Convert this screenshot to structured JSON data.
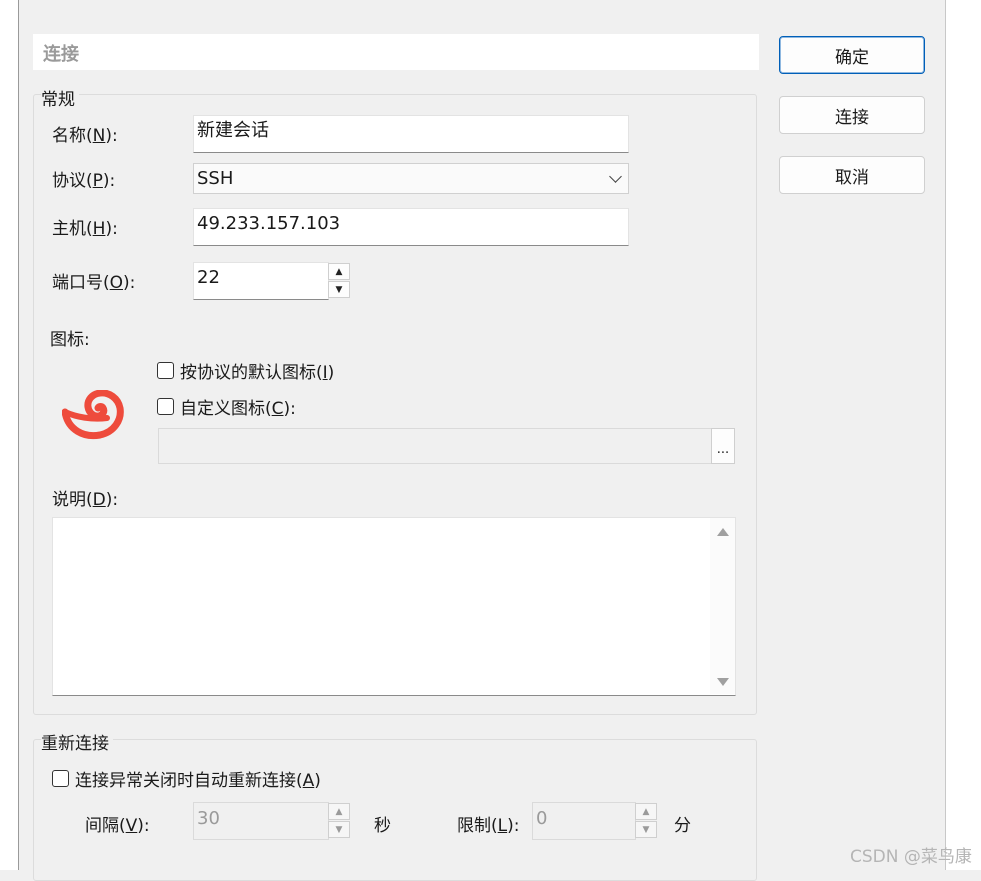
{
  "header": {
    "title": "连接"
  },
  "general": {
    "group_title": "常规",
    "name_label_pre": "名称(",
    "name_label_key": "N",
    "name_label_post": "):",
    "name_value": "新建会话",
    "protocol_label_pre": "协议(",
    "protocol_label_key": "P",
    "protocol_label_post": "):",
    "protocol_value": "SSH",
    "host_label_pre": "主机(",
    "host_label_key": "H",
    "host_label_post": "):",
    "host_value": "49.233.157.103",
    "port_label_pre": "端口号(",
    "port_label_key": "O",
    "port_label_post": "):",
    "port_value": "22",
    "icon_label": "图标:",
    "default_icon_label_pre": "按协议的默认图标(",
    "default_icon_label_key": "I",
    "default_icon_label_post": ")",
    "custom_icon_label_pre": "自定义图标(",
    "custom_icon_label_key": "C",
    "custom_icon_label_post": "):",
    "browse_label": "...",
    "desc_label_pre": "说明(",
    "desc_label_key": "D",
    "desc_label_post": "):"
  },
  "reconnect": {
    "group_title": "重新连接",
    "auto_label_pre": "连接异常关闭时自动重新连接(",
    "auto_label_key": "A",
    "auto_label_post": ")",
    "interval_label_pre": "间隔(",
    "interval_label_key": "V",
    "interval_label_post": "):",
    "interval_value": "30",
    "interval_unit": "秒",
    "limit_label_pre": "限制(",
    "limit_label_key": "L",
    "limit_label_post": "):",
    "limit_value": "0",
    "limit_unit": "分"
  },
  "buttons": {
    "ok": "确定",
    "connect": "连接",
    "cancel": "取消"
  },
  "watermark": "CSDN @菜鸟康",
  "colors": {
    "accent": "#005fb8",
    "logo": "#ee4b3c"
  }
}
